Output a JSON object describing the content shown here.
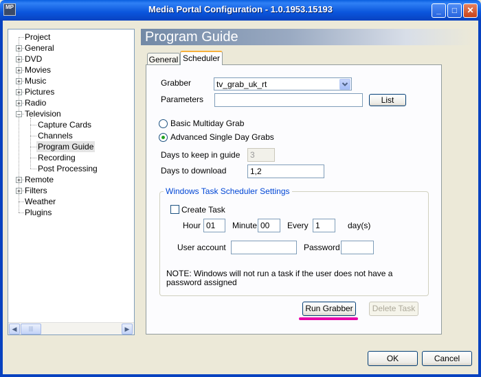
{
  "window": {
    "title": "Media Portal Configuration - 1.0.1953.15193",
    "icon_text": "MP"
  },
  "title_buttons": {
    "minimize": "_",
    "maximize": "□",
    "close": "✕"
  },
  "tree": {
    "items": [
      {
        "label": "Project",
        "expander": ""
      },
      {
        "label": "General",
        "expander": "+"
      },
      {
        "label": "DVD",
        "expander": "+"
      },
      {
        "label": "Movies",
        "expander": "+"
      },
      {
        "label": "Music",
        "expander": "+"
      },
      {
        "label": "Pictures",
        "expander": "+"
      },
      {
        "label": "Radio",
        "expander": "+"
      },
      {
        "label": "Television",
        "expander": "−"
      },
      {
        "label": "Capture Cards",
        "expander": ""
      },
      {
        "label": "Channels",
        "expander": ""
      },
      {
        "label": "Program Guide",
        "expander": ""
      },
      {
        "label": "Recording",
        "expander": ""
      },
      {
        "label": "Post Processing",
        "expander": ""
      },
      {
        "label": "Remote",
        "expander": "+"
      },
      {
        "label": "Filters",
        "expander": "+"
      },
      {
        "label": "Weather",
        "expander": ""
      },
      {
        "label": "Plugins",
        "expander": ""
      }
    ],
    "selected": "Program Guide"
  },
  "scrollbar": {
    "left_arrow": "◀",
    "right_arrow": "▶",
    "thumb_grip": "|||"
  },
  "page": {
    "title": "Program Guide"
  },
  "tabs": [
    {
      "label": "General"
    },
    {
      "label": "Scheduler"
    }
  ],
  "scheduler": {
    "grabber_label": "Grabber",
    "grabber_value": "tv_grab_uk_rt",
    "parameters_label": "Parameters",
    "parameters_value": "",
    "list_button": "List",
    "radio_basic": "Basic Multiday Grab",
    "radio_advanced": "Advanced Single Day Grabs",
    "days_keep_label": "Days to keep in guide",
    "days_keep_value": "3",
    "days_download_label": "Days to download",
    "days_download_value": "1,2",
    "group_title": "Windows Task Scheduler Settings",
    "create_task_label": "Create Task",
    "hour_label": "Hour",
    "hour_value": "01",
    "minute_label": "Minute",
    "minute_value": "00",
    "every_label": "Every",
    "every_value": "1",
    "days_unit": "day(s)",
    "user_account_label": "User account",
    "user_account_value": "",
    "password_label": "Password",
    "password_value": "",
    "note": "NOTE: Windows will not run a task if the user does not have a password assigned",
    "run_grabber_button": "Run Grabber",
    "delete_task_button": "Delete Task"
  },
  "footer": {
    "ok_button": "OK",
    "cancel_button": "Cancel"
  },
  "colors": {
    "titlebar": "#0a55dc",
    "highlight_underline": "#e600a8",
    "group_title": "#0046d5"
  }
}
